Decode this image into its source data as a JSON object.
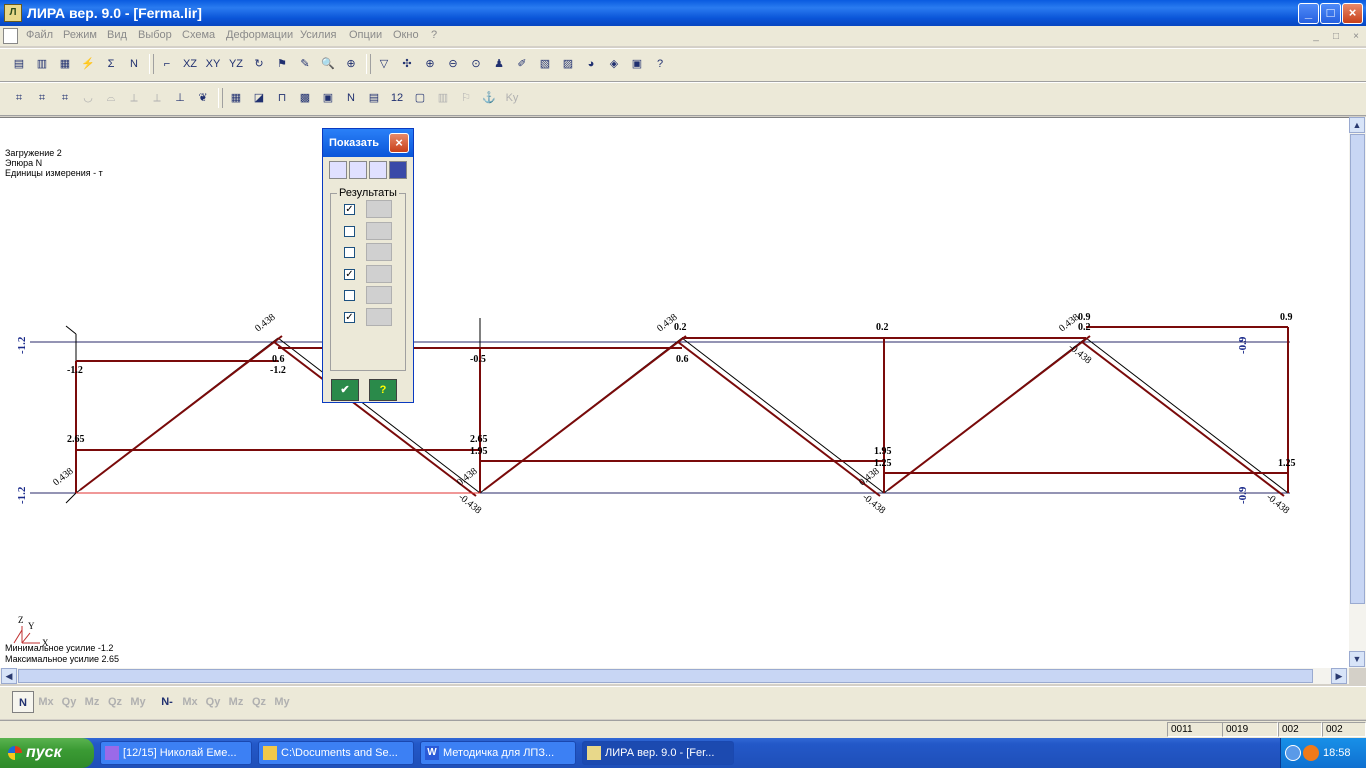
{
  "window": {
    "title": "ЛИРА  вер. 9.0 - [Ferma.lir]",
    "icon": "lira-app-icon",
    "minimize": "_",
    "maximize": "□",
    "close": "×"
  },
  "menu": [
    "Файл",
    "Режим",
    "Вид",
    "Выбор",
    "Схема",
    "Деформации",
    "Усилия",
    "Опции",
    "Окно",
    "?"
  ],
  "mdi_controls": [
    "_",
    "□",
    "×"
  ],
  "toolbar1": [
    {
      "icon": "open-icon",
      "g": "▤"
    },
    {
      "icon": "save-icon",
      "g": "▥"
    },
    {
      "icon": "print-icon",
      "g": "▦"
    },
    {
      "icon": "load-icon",
      "g": "⚡"
    },
    {
      "icon": "load-sum-icon",
      "g": "Σ"
    },
    {
      "icon": "load-n-icon",
      "g": "N"
    },
    {
      "icon": "axes-icon",
      "g": "⌐"
    },
    {
      "icon": "xz-icon",
      "g": "XZ"
    },
    {
      "icon": "xy-icon",
      "g": "XY"
    },
    {
      "icon": "yz-icon",
      "g": "YZ"
    },
    {
      "icon": "rotate-icon",
      "g": "↻"
    },
    {
      "icon": "flag-icon",
      "g": "⚑"
    },
    {
      "icon": "pencil-icon",
      "g": "✎"
    },
    {
      "icon": "zoom-icon",
      "g": "🔍"
    },
    {
      "icon": "zoom-all-icon",
      "g": "⊕"
    },
    {
      "icon": "filter-icon",
      "g": "▽"
    },
    {
      "icon": "fragment-icon",
      "g": "✣"
    },
    {
      "icon": "zoom-in-icon",
      "g": "⊕"
    },
    {
      "icon": "zoom-out-icon",
      "g": "⊖"
    },
    {
      "icon": "zoom-window-icon",
      "g": "⊙"
    },
    {
      "icon": "pin-icon",
      "g": "♟"
    },
    {
      "icon": "marker-icon",
      "g": "✐"
    },
    {
      "icon": "layers-icon",
      "g": "▧"
    },
    {
      "icon": "edit-icon",
      "g": "▨"
    },
    {
      "icon": "palette-icon",
      "g": "◕"
    },
    {
      "icon": "map-icon",
      "g": "◈"
    },
    {
      "icon": "box-icon",
      "g": "▣"
    },
    {
      "icon": "help-pointer-icon",
      "g": "?"
    }
  ],
  "toolbar2": [
    {
      "icon": "truss-icon",
      "g": "⌗"
    },
    {
      "icon": "truss-grid-icon",
      "g": "⌗"
    },
    {
      "icon": "truss-diag-icon",
      "g": "⌗"
    },
    {
      "icon": "arc-icon",
      "g": "◡",
      "dis": true
    },
    {
      "icon": "dome-icon",
      "g": "⌓",
      "dis": true
    },
    {
      "icon": "column-icon",
      "g": "⟂",
      "dis": true
    },
    {
      "icon": "column2-icon",
      "g": "⟂",
      "dis": true
    },
    {
      "icon": "support-icon",
      "g": "⊥"
    },
    {
      "icon": "leaf-icon",
      "g": "❦"
    },
    {
      "icon": "grid-icon",
      "g": "▦"
    },
    {
      "icon": "diag-fill-icon",
      "g": "◪"
    },
    {
      "icon": "frame-icon",
      "g": "⊓"
    },
    {
      "icon": "mosaic-icon",
      "g": "▩"
    },
    {
      "icon": "plate-icon",
      "g": "▣"
    },
    {
      "icon": "node-numbers-icon",
      "g": "N"
    },
    {
      "icon": "element-numbers-icon",
      "g": "▤"
    },
    {
      "icon": "values-icon",
      "g": "12"
    },
    {
      "icon": "sheet-icon",
      "g": "▢"
    },
    {
      "icon": "hist-icon",
      "g": "▥",
      "dis": true
    },
    {
      "icon": "flag2-icon",
      "g": "⚐",
      "dis": true
    },
    {
      "icon": "anchor-icon",
      "g": "⚓",
      "dis": true
    },
    {
      "icon": "ky-icon",
      "g": "Ky",
      "dis": true
    }
  ],
  "canvas_info": {
    "loading": "Загружение  2",
    "diagram": "Эпюра  N",
    "units": "Единицы измерения - т",
    "min_force": "Минимальное усилие  -1.2",
    "max_force": "Максимальное усилие  2.65"
  },
  "axes_labels": {
    "z": "Z",
    "y": "Y",
    "x": "X"
  },
  "palette": {
    "title": "Показать",
    "top_icons": [
      "rod-icon",
      "node-icon",
      "rotate-node-icon",
      "grid-view-icon"
    ],
    "group_label": "Результаты",
    "results": [
      {
        "checked": true,
        "icon": "deformed-plate-icon"
      },
      {
        "checked": false,
        "icon": "displacement-icon"
      },
      {
        "checked": false,
        "icon": "scale-diagram-icon"
      },
      {
        "checked": true,
        "icon": "mosaic-result-icon"
      },
      {
        "checked": false,
        "icon": "isolines-icon"
      },
      {
        "checked": true,
        "icon": "values-label-icon"
      }
    ],
    "ok_label": "✔",
    "help_label": "?"
  },
  "bottom_toolbar": [
    "N",
    "Mx",
    "Qy",
    "Mz",
    "Qz",
    "My",
    "N-",
    "Mx",
    "Qy",
    "Mz",
    "Qz",
    "My"
  ],
  "status_cells": [
    "0011",
    "0019",
    "002",
    "002"
  ],
  "taskbar": {
    "start": "пуск",
    "tasks": [
      {
        "label": "[12/15] Николай Еме...",
        "icon": "messenger-icon"
      },
      {
        "label": "C:\\Documents and Se...",
        "icon": "folder-icon"
      },
      {
        "label": "Методичка для ЛПЗ...",
        "icon": "word-icon"
      },
      {
        "label": "ЛИРА  вер. 9.0 - [Fer...",
        "icon": "lira-task-icon"
      }
    ],
    "clock": "18:58"
  },
  "chart_data": {
    "type": "truss-force-diagram",
    "title": "Эпюра N",
    "units": "т",
    "labels_top": [
      "0.438",
      "-1.2",
      "-1.2",
      "0.6",
      "-0.5",
      "0.438",
      "0.2",
      "0.6",
      "0.2",
      "0.438",
      "0.9",
      "0.2",
      "0.9",
      "-0.438",
      "-0.9"
    ],
    "labels_bottom": [
      "2.65",
      "0.438",
      "2.65",
      "1.95",
      "0.438",
      "-0.438",
      "1.95",
      "1.25",
      "0.438",
      "-0.438",
      "1.25",
      "-0.438",
      "-0.9"
    ],
    "axis_labels": [
      "-1.2",
      "-1.2",
      "-0.9",
      "-0.9"
    ]
  }
}
